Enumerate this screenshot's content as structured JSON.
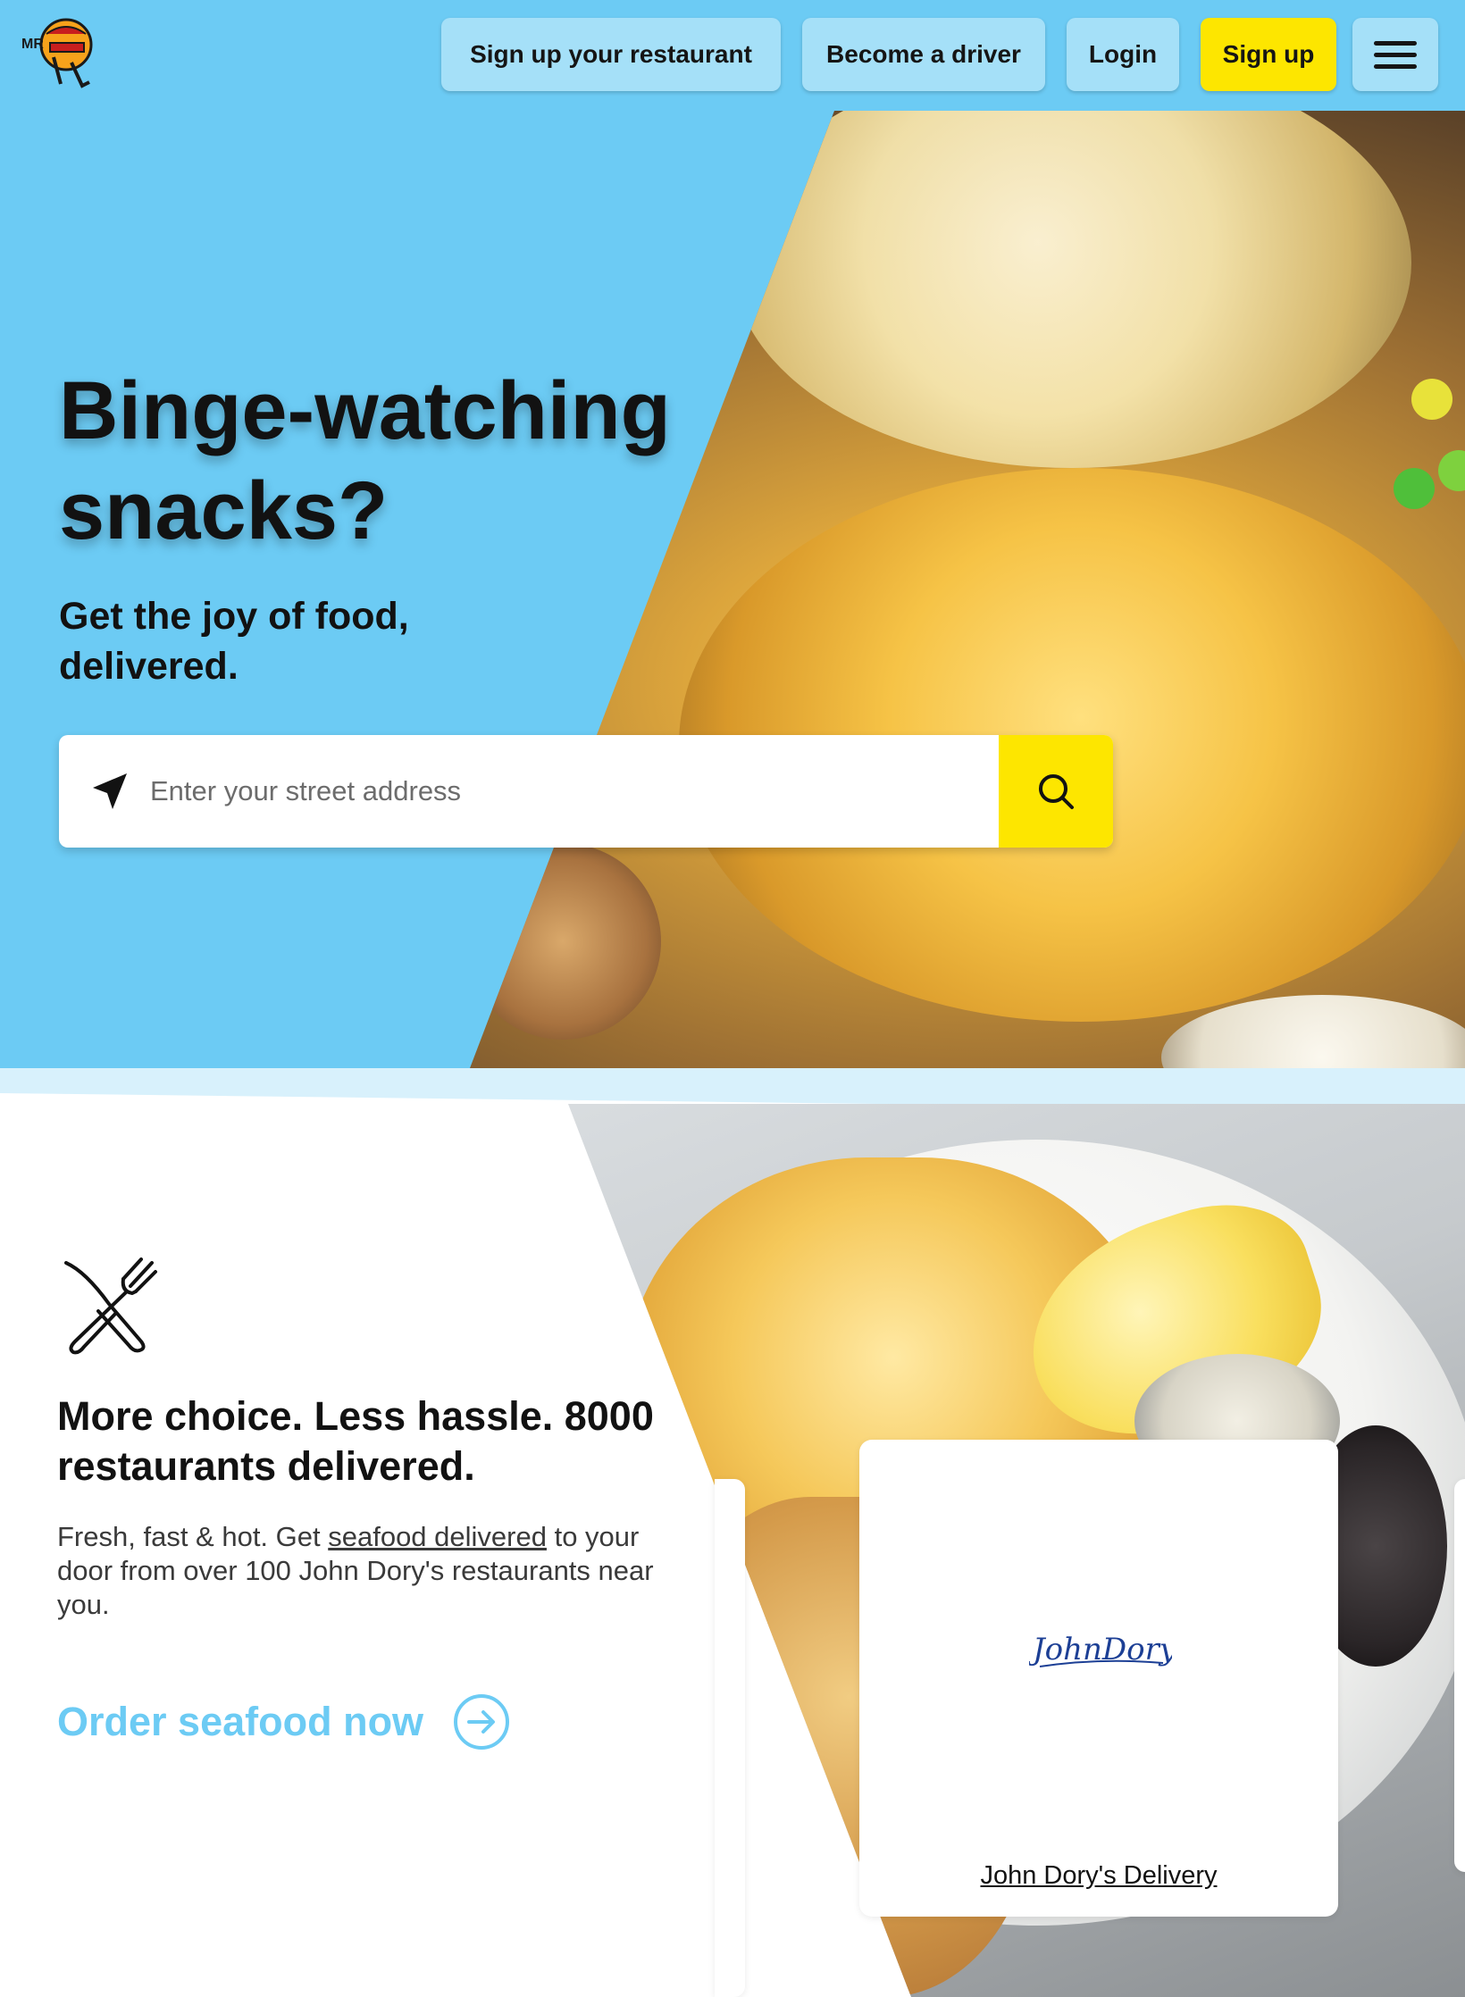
{
  "header": {
    "logo_icon": "mr-d-mascot-logo",
    "logo_text": "MR",
    "nav": {
      "signup_restaurant": "Sign up your restaurant",
      "become_driver": "Become a driver",
      "login": "Login",
      "signup": "Sign up"
    },
    "menu_icon": "hamburger-menu-icon"
  },
  "hero": {
    "title": "Binge-watching snacks?",
    "subtitle": "Get the joy of food, delivered.",
    "search": {
      "placeholder": "Enter your street address",
      "value": "",
      "location_icon": "navigation-arrow-icon",
      "button_icon": "search-icon"
    },
    "image": "snacks-popcorn-chips-photo"
  },
  "section": {
    "icon": "knife-fork-icon",
    "title": "More choice. Less hassle. 8000 restaurants delivered.",
    "text_before": "Fresh, fast & hot. Get ",
    "text_link": "seafood delivered",
    "text_after": " to your door from over 100 John Dory's restaurants near you.",
    "cta": "Order seafood now",
    "cta_icon": "arrow-right-circle-icon",
    "image": "fish-and-chips-photo",
    "card": {
      "logo_text": "JohnDory's",
      "link": "John Dory's Delivery"
    }
  },
  "colors": {
    "brand_blue": "#6ccbf4",
    "light_blue": "#a5e0f8",
    "accent_yellow": "#fde600",
    "text_dark": "#121212"
  }
}
